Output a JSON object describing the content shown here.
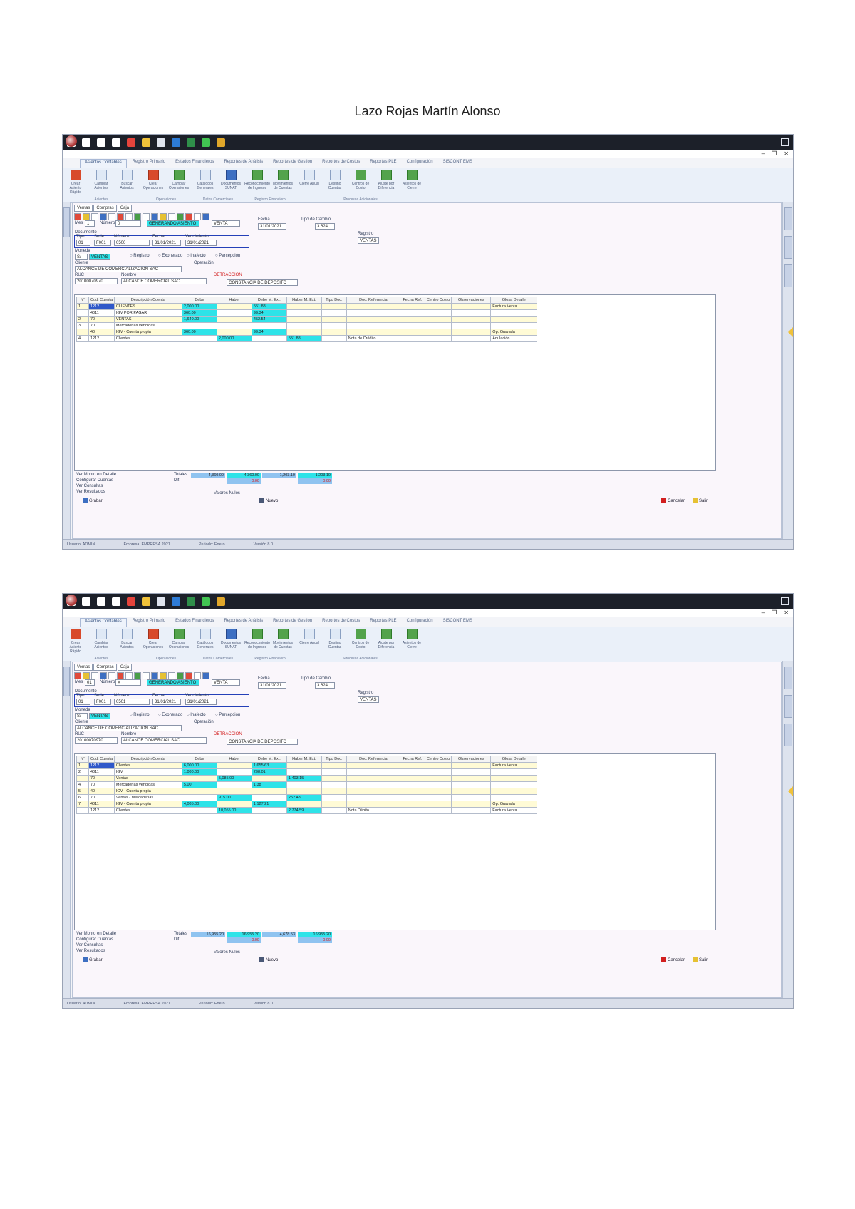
{
  "page_title": "Lazo Rojas Martín Alonso",
  "taskbar": {
    "icons": [
      {
        "name": "windows-start-icon",
        "color": "#ffffff"
      },
      {
        "name": "search-icon",
        "color": "#ffffff"
      },
      {
        "name": "cortana-icon",
        "color": "#ffffff"
      },
      {
        "name": "task-view-icon",
        "color": "#ffffff"
      },
      {
        "name": "chrome-icon",
        "color": "#e5443c"
      },
      {
        "name": "file-explorer-icon",
        "color": "#f0c23a"
      },
      {
        "name": "store-icon",
        "color": "#dfe4ee"
      },
      {
        "name": "outlook-icon",
        "color": "#2d7bd6"
      },
      {
        "name": "excel-icon",
        "color": "#2f8f4a"
      },
      {
        "name": "whatsapp-icon",
        "color": "#41c452"
      },
      {
        "name": "app-icon",
        "color": "#e0a72a"
      }
    ]
  },
  "ribbon": {
    "tabs": [
      "Asientos Contables",
      "Registro Primario",
      "Estados Financieros",
      "Reportes de Análisis",
      "Reportes de Gestión",
      "Reportes de Costos",
      "Reportes PLE",
      "Configuración",
      "SISCONT EMS"
    ],
    "groups": [
      {
        "name": "Asientos",
        "buttons": [
          {
            "label": "Crear Asiento Rápido",
            "color": "red"
          },
          {
            "label": "Cambiar Asientos",
            "color": ""
          },
          {
            "label": "Buscar Asientos",
            "color": ""
          }
        ]
      },
      {
        "name": "Operaciones",
        "buttons": [
          {
            "label": "Crear Operaciones",
            "color": "red"
          },
          {
            "label": "Cambiar Operaciones",
            "color": "green"
          }
        ]
      },
      {
        "name": "Datos Comerciales",
        "buttons": [
          {
            "label": "Catálogos Generales",
            "color": ""
          },
          {
            "label": "Documentos SUNAT",
            "color": "blue"
          }
        ]
      },
      {
        "name": "Registro Financiero",
        "buttons": [
          {
            "label": "Reconocimiento de Ingresos",
            "color": "green"
          },
          {
            "label": "Movimientos de Cuentas",
            "color": "green"
          }
        ]
      },
      {
        "name": "Procesos Adicionales",
        "buttons": [
          {
            "label": "Cierre Anual",
            "color": ""
          },
          {
            "label": "Destino Cuentas",
            "color": ""
          },
          {
            "label": "Centros de Costo",
            "color": "green"
          },
          {
            "label": "Ajuste por Diferencia",
            "color": "green"
          },
          {
            "label": "Asientos de Cierre",
            "color": "green"
          }
        ]
      }
    ]
  },
  "shots": [
    {
      "doc_tabs": [
        "Ventas",
        "Compras",
        "Caja"
      ],
      "form": {
        "mes_label": "Mes",
        "mes_value": "1",
        "num_label": "Número",
        "num_value": "0",
        "status_value": "GENERANDO ASIENTO",
        "glosa_value": "VENTA",
        "fecha_label": "Fecha",
        "fecha_value": "31/01/2021",
        "moneda_label": "Moneda",
        "moneda_value": "S/",
        "registro_label": "Registro",
        "registro_value": "VENTAS",
        "tipo_cambio_label": "Tipo de Cambio",
        "tipo_cambio_value": "3.624",
        "documento_label": "Documento",
        "tipo_label": "Tipo",
        "serie_label": "Serie",
        "numero_label": "Número",
        "tipo_value": "01",
        "serie_value": "F001",
        "numero_value": "0500",
        "fecha_doc_label": "Fecha",
        "fecha_doc_value": "31/01/2021",
        "vencimiento_label": "Vencimiento",
        "vencimiento_value": "31/01/2021",
        "cliente_label": "Cliente",
        "cliente_value": "ALCANCE DE COMERCIALIZACIÓN SAC",
        "ruc_label": "RUC",
        "ruc_value": "20100070970",
        "nombre_label": "Nombre",
        "nombre_value": "ALCANCE COMERCIAL SAC",
        "operacion_label": "Operación",
        "operacion_value": "",
        "detraccion_label": "DETRACCIÓN",
        "detraccion_value": "CONSTANCIA DE DEPÓSITO",
        "options": [
          "Registro",
          "Exonerado",
          "Inafecto",
          "Percepción"
        ]
      },
      "headers": [
        "N°",
        "Cod. Cuenta",
        "Descripción Cuenta",
        "Debe",
        "Haber",
        "Debe M. Ext.",
        "Haber M. Ext.",
        "Tipo Doc.",
        "Doc. Referencia",
        "Fecha Ref.",
        "Centro Costo",
        "Observaciones",
        "Glosa Detalle"
      ],
      "rows": [
        [
          "1",
          "1212",
          "CLIENTES",
          "2,000.00",
          "",
          "551.88",
          "",
          "",
          "",
          "",
          "",
          "",
          "Factura Venta"
        ],
        [
          "",
          "4011",
          "IGV POR PAGAR",
          "360.00",
          "",
          "99.34",
          "",
          "",
          "",
          "",
          "",
          "",
          ""
        ],
        [
          "2",
          "70",
          "VENTAS",
          "1,640.00",
          "",
          "452.54",
          "",
          "",
          "",
          "",
          "",
          "",
          ""
        ],
        [
          "3",
          "70",
          "Mercaderías vendidas",
          "",
          "",
          "",
          "",
          "",
          "",
          "",
          "",
          "",
          ""
        ],
        [
          "",
          "40",
          "IGV - Cuenta propia",
          "360.00",
          "",
          "99.34",
          "",
          "",
          "",
          "",
          "",
          "",
          "Op. Gravada"
        ],
        [
          "4",
          "1212",
          "Clientes",
          "",
          "2,000.00",
          "",
          "551.88",
          "",
          "Nota de Crédito",
          "",
          "",
          "",
          "Anulación"
        ]
      ],
      "totals": {
        "label": "Totales",
        "dif_label": "Dif.",
        "debe": "4,360.00",
        "haber": "4,360.00",
        "debe_me": "1,203.10",
        "haber_me": "1,203.10",
        "dif_debe": "0.00",
        "dif_haber": "0.00"
      },
      "bottom_left": [
        "Ver Monto en Detalle",
        "Configurar Cuentas",
        "Ver Consultas",
        "Ver Resultados"
      ],
      "bottom_center": "Valores Nulos",
      "btn_grabar": "Grabar",
      "btn_nuevo": "Nuevo",
      "btn_cancelar": "Cancelar",
      "btn_salir": "Salir",
      "status": [
        "Usuario: ADMIN",
        "Empresa: EMPRESA 2021",
        "Periodo: Enero",
        "Versión 8.0"
      ]
    },
    {
      "doc_tabs": [
        "Ventas",
        "Compras",
        "Caja"
      ],
      "form": {
        "mes_label": "Mes",
        "mes_value": "01",
        "num_label": "Número",
        "num_value": "X",
        "status_value": "GENERANDO ASIENTO",
        "glosa_value": "VENTA",
        "fecha_label": "Fecha",
        "fecha_value": "31/01/2021",
        "moneda_label": "Moneda",
        "moneda_value": "S/",
        "registro_label": "Registro",
        "registro_value": "VENTAS",
        "tipo_cambio_label": "Tipo de Cambio",
        "tipo_cambio_value": "3.624",
        "documento_label": "Documento",
        "tipo_label": "Tipo",
        "serie_label": "Serie",
        "numero_label": "Número",
        "tipo_value": "01",
        "serie_value": "F001",
        "numero_value": "0501",
        "fecha_doc_label": "Fecha",
        "fecha_doc_value": "31/01/2021",
        "vencimiento_label": "Vencimiento",
        "vencimiento_value": "31/01/2021",
        "cliente_label": "Cliente",
        "cliente_value": "ALCANCE DE COMERCIALIZACIÓN SAC",
        "ruc_label": "RUC",
        "ruc_value": "20100070970",
        "nombre_label": "Nombre",
        "nombre_value": "ALCANCE COMERCIAL SAC",
        "operacion_label": "Operación",
        "operacion_value": "",
        "detraccion_label": "DETRACCIÓN",
        "detraccion_value": "CONSTANCIA DE DEPÓSITO",
        "options": [
          "Registro",
          "Exonerado",
          "Inafecto",
          "Percepción"
        ]
      },
      "headers": [
        "N°",
        "Cod. Cuenta",
        "Descripción Cuenta",
        "Debe",
        "Haber",
        "Debe M. Ext.",
        "Haber M. Ext.",
        "Tipo Doc.",
        "Doc. Referencia",
        "Fecha Ref.",
        "Centro Costo",
        "Observaciones",
        "Glosa Detalle"
      ],
      "rows": [
        [
          "1",
          "1212",
          "Clientes",
          "6,000.00",
          "",
          "1,655.63",
          "",
          "",
          "",
          "",
          "",
          "",
          "Factura Venta"
        ],
        [
          "2",
          "4011",
          "IGV",
          "1,080.00",
          "",
          "298.01",
          "",
          "",
          "",
          "",
          "",
          "",
          ""
        ],
        [
          "",
          "70",
          "Ventas",
          "",
          "5,085.00",
          "",
          "1,403.15",
          "",
          "",
          "",
          "",
          "",
          ""
        ],
        [
          "4",
          "70",
          "Mercaderías vendidas",
          "5.00",
          "",
          "1.38",
          "",
          "",
          "",
          "",
          "",
          "",
          ""
        ],
        [
          "5",
          "40",
          "IGV - Cuenta propia",
          "",
          "",
          "",
          "",
          "",
          "",
          "",
          "",
          "",
          ""
        ],
        [
          "6",
          "70",
          "Ventas - Mercaderías",
          "",
          "915.00",
          "",
          "252.48",
          "",
          "",
          "",
          "",
          "",
          ""
        ],
        [
          "7",
          "4011",
          "IGV - Cuenta propia",
          "4,085.00",
          "",
          "1,127.21",
          "",
          "",
          "",
          "",
          "",
          "",
          "Op. Gravada"
        ],
        [
          "",
          "1212",
          "Clientes",
          "",
          "10,055.00",
          "",
          "2,774.59",
          "",
          "Nota Débito",
          "",
          "",
          "",
          "Factura Venta"
        ]
      ],
      "totals": {
        "label": "Totales",
        "dif_label": "Dif.",
        "debe": "16,955.20",
        "haber": "16,955.20",
        "debe_me": "4,678.53",
        "haber_me": "16,955.20",
        "dif_debe": "0.00",
        "dif_haber": "0.00"
      },
      "bottom_left": [
        "Ver Monto en Detalle",
        "Configurar Cuentas",
        "Ver Consultas",
        "Ver Resultados"
      ],
      "bottom_center": "Valores Nulos",
      "btn_grabar": "Grabar",
      "btn_nuevo": "Nuevo",
      "btn_cancelar": "Cancelar",
      "btn_salir": "Salir",
      "status": [
        "Usuario: ADMIN",
        "Empresa: EMPRESA 2021",
        "Periodo: Enero",
        "Versión 8.0"
      ]
    }
  ]
}
